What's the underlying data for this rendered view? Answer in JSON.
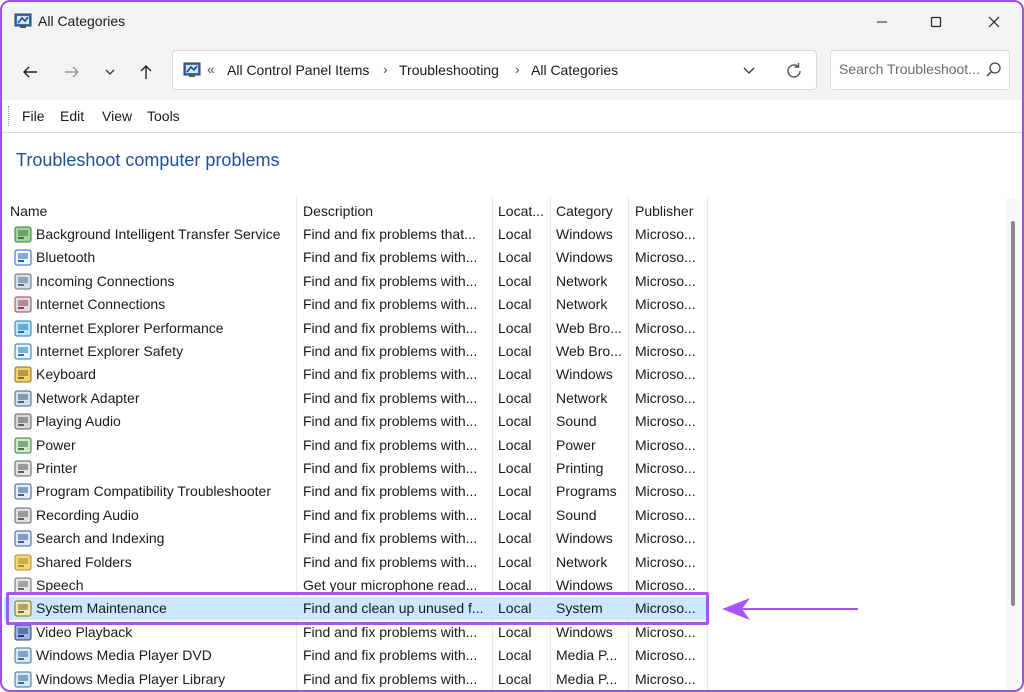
{
  "window": {
    "title": "All Categories"
  },
  "address": {
    "overflow": "«",
    "segments": [
      "All Control Panel Items",
      "Troubleshooting",
      "All Categories"
    ]
  },
  "search": {
    "placeholder": "Search Troubleshoot..."
  },
  "menu": [
    "File",
    "Edit",
    "View",
    "Tools"
  ],
  "heading": "Troubleshoot computer problems",
  "columns": {
    "name": "Name",
    "description": "Description",
    "location": "Locat...",
    "category": "Category",
    "publisher": "Publisher"
  },
  "rows": [
    {
      "name": "Background Intelligent Transfer Service",
      "description": "Find and fix problems that...",
      "location": "Local",
      "category": "Windows",
      "publisher": "Microso...",
      "icon": "bits-icon"
    },
    {
      "name": "Bluetooth",
      "description": "Find and fix problems with...",
      "location": "Local",
      "category": "Windows",
      "publisher": "Microso...",
      "icon": "bluetooth-icon"
    },
    {
      "name": "Incoming Connections",
      "description": "Find and fix problems with...",
      "location": "Local",
      "category": "Network",
      "publisher": "Microso...",
      "icon": "incoming-connections-icon"
    },
    {
      "name": "Internet Connections",
      "description": "Find and fix problems with...",
      "location": "Local",
      "category": "Network",
      "publisher": "Microso...",
      "icon": "internet-connections-icon"
    },
    {
      "name": "Internet Explorer Performance",
      "description": "Find and fix problems with...",
      "location": "Local",
      "category": "Web Bro...",
      "publisher": "Microso...",
      "icon": "ie-performance-icon"
    },
    {
      "name": "Internet Explorer Safety",
      "description": "Find and fix problems with...",
      "location": "Local",
      "category": "Web Bro...",
      "publisher": "Microso...",
      "icon": "ie-safety-icon"
    },
    {
      "name": "Keyboard",
      "description": "Find and fix problems with...",
      "location": "Local",
      "category": "Windows",
      "publisher": "Microso...",
      "icon": "keyboard-icon"
    },
    {
      "name": "Network Adapter",
      "description": "Find and fix problems with...",
      "location": "Local",
      "category": "Network",
      "publisher": "Microso...",
      "icon": "network-adapter-icon"
    },
    {
      "name": "Playing Audio",
      "description": "Find and fix problems with...",
      "location": "Local",
      "category": "Sound",
      "publisher": "Microso...",
      "icon": "playing-audio-icon"
    },
    {
      "name": "Power",
      "description": "Find and fix problems with...",
      "location": "Local",
      "category": "Power",
      "publisher": "Microso...",
      "icon": "power-icon"
    },
    {
      "name": "Printer",
      "description": "Find and fix problems with...",
      "location": "Local",
      "category": "Printing",
      "publisher": "Microso...",
      "icon": "printer-icon"
    },
    {
      "name": "Program Compatibility Troubleshooter",
      "description": "Find and fix problems with...",
      "location": "Local",
      "category": "Programs",
      "publisher": "Microso...",
      "icon": "program-compat-icon"
    },
    {
      "name": "Recording Audio",
      "description": "Find and fix problems with...",
      "location": "Local",
      "category": "Sound",
      "publisher": "Microso...",
      "icon": "recording-audio-icon"
    },
    {
      "name": "Search and Indexing",
      "description": "Find and fix problems with...",
      "location": "Local",
      "category": "Windows",
      "publisher": "Microso...",
      "icon": "search-indexing-icon"
    },
    {
      "name": "Shared Folders",
      "description": "Find and fix problems with...",
      "location": "Local",
      "category": "Network",
      "publisher": "Microso...",
      "icon": "shared-folders-icon"
    },
    {
      "name": "Speech",
      "description": "Get your microphone read...",
      "location": "Local",
      "category": "Windows",
      "publisher": "Microso...",
      "icon": "speech-icon"
    },
    {
      "name": "System Maintenance",
      "description": "Find and clean up unused f...",
      "location": "Local",
      "category": "System",
      "publisher": "Microso...",
      "icon": "system-maintenance-icon",
      "selected": true
    },
    {
      "name": "Video Playback",
      "description": "Find and fix problems with...",
      "location": "Local",
      "category": "Windows",
      "publisher": "Microso...",
      "icon": "video-playback-icon"
    },
    {
      "name": "Windows Media Player DVD",
      "description": "Find and fix problems with...",
      "location": "Local",
      "category": "Media P...",
      "publisher": "Microso...",
      "icon": "wmp-dvd-icon"
    },
    {
      "name": "Windows Media Player Library",
      "description": "Find and fix problems with...",
      "location": "Local",
      "category": "Media P...",
      "publisher": "Microso...",
      "icon": "wmp-library-icon"
    }
  ],
  "colors": {
    "accent": "#a855f7",
    "selection": "#cce8ff",
    "heading": "#1f4e9a"
  }
}
